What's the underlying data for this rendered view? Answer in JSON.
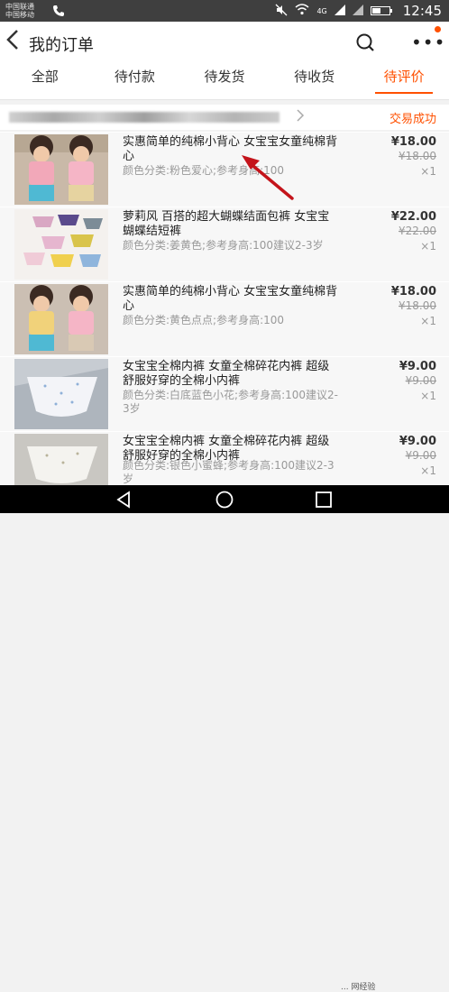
{
  "status_bar": {
    "carrier1": "中国联通",
    "carrier2": "中国移动",
    "network": "4G",
    "time": "12:45",
    "battery_level": 0.5
  },
  "header": {
    "title": "我的订单",
    "back_icon": "chevron-left-icon",
    "search_icon": "search-icon",
    "more_icon": "more-dots-icon",
    "more_label": "•••",
    "notification_color": "#ff5000"
  },
  "tabs": [
    {
      "label": "全部"
    },
    {
      "label": "待付款"
    },
    {
      "label": "待发货"
    },
    {
      "label": "待收货"
    },
    {
      "label": "待评价",
      "active": true
    }
  ],
  "order": {
    "status": "交易成功",
    "items": [
      {
        "name": "实惠简单的纯棉小背心 女宝宝女童纯棉背心",
        "spec": "颜色分类:粉色爱心;参考身高:100",
        "price": "¥18.00",
        "original_price": "¥18.00",
        "quantity": "×1"
      },
      {
        "name": "萝莉风 百搭的超大蝴蝶结面包裤 女宝宝蝴蝶结短裤",
        "spec": "颜色分类:姜黄色;参考身高:100建议2-3岁",
        "price": "¥22.00",
        "original_price": "¥22.00",
        "quantity": "×1"
      },
      {
        "name": "实惠简单的纯棉小背心 女宝宝女童纯棉背心",
        "spec": "颜色分类:黄色点点;参考身高:100",
        "price": "¥18.00",
        "original_price": "¥18.00",
        "quantity": "×1"
      },
      {
        "name": "女宝宝全棉内裤 女童全棉碎花内裤 超级舒服好穿的全棉小内裤",
        "spec": "颜色分类:白底蓝色小花;参考身高:100建议2-3岁",
        "price": "¥9.00",
        "original_price": "¥9.00",
        "quantity": "×1"
      },
      {
        "name": "女宝宝全棉内裤 女童全棉碎花内裤 超级舒服好穿的全棉小内裤",
        "spec": "颜色分类:银色小蜜蜂;参考身高:100建议2-3岁",
        "price": "¥9.00",
        "original_price": "¥9.00",
        "quantity": "×1"
      }
    ]
  },
  "annotation": {
    "arrow_color": "#c4141b"
  },
  "nav": {
    "back_icon": "triangle-back-icon",
    "home_icon": "circle-home-icon",
    "recent_icon": "square-recent-icon"
  },
  "watermark": "... 网经验"
}
